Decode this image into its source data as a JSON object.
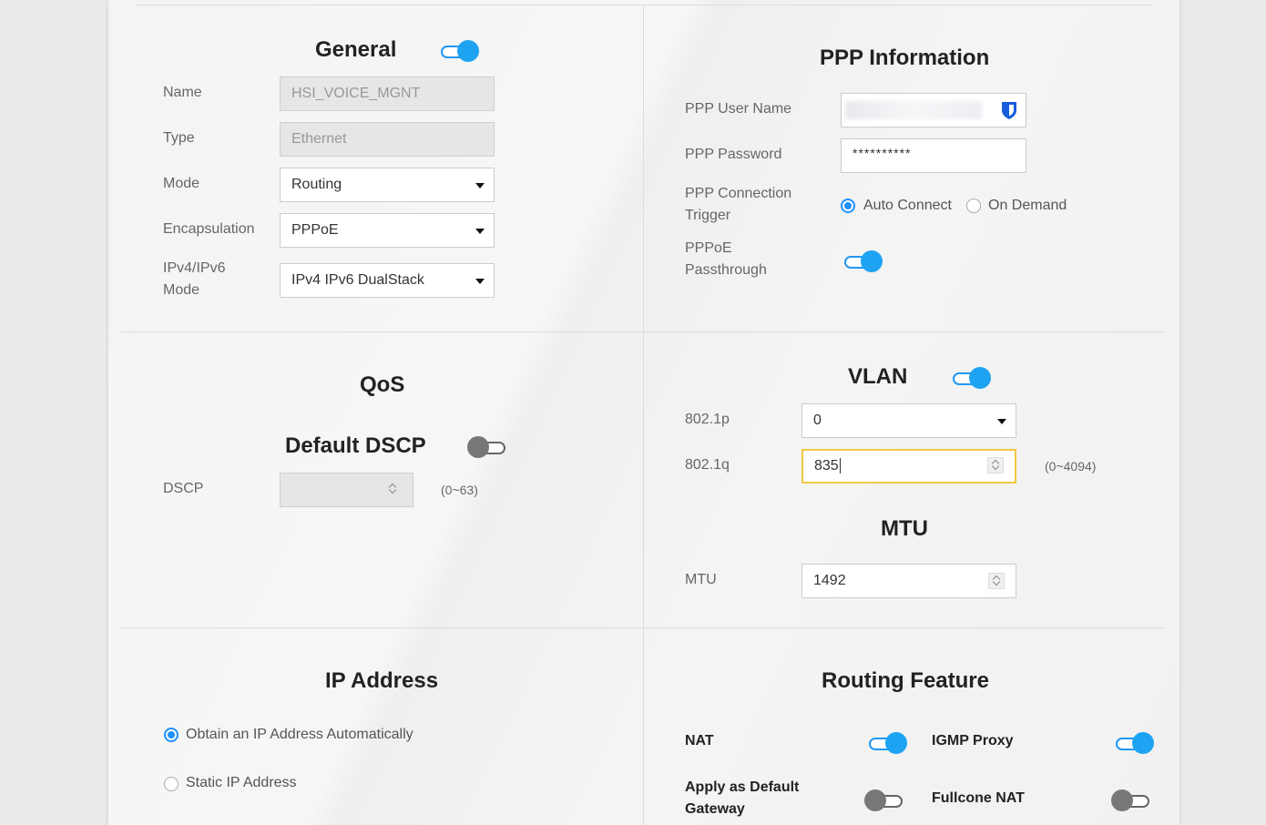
{
  "general": {
    "title": "General",
    "name_label": "Name",
    "name_value": "HSI_VOICE_MGNT",
    "type_label": "Type",
    "type_value": "Ethernet",
    "mode_label": "Mode",
    "mode_value": "Routing",
    "encap_label": "Encapsulation",
    "encap_value": "PPPoE",
    "ipmode_label_1": "IPv4/IPv6",
    "ipmode_label_2": "Mode",
    "ipmode_value": "IPv4 IPv6 DualStack",
    "enabled": true
  },
  "ppp": {
    "title": "PPP Information",
    "user_label": "PPP User Name",
    "user_value": "",
    "password_label": "PPP Password",
    "password_value": "**********",
    "trigger_label_1": "PPP Connection",
    "trigger_label_2": "Trigger",
    "auto_connect": "Auto Connect",
    "on_demand": "On Demand",
    "passthrough_label_1": "PPPoE",
    "passthrough_label_2": "Passthrough",
    "passthrough_enabled": true
  },
  "qos": {
    "title": "QoS",
    "dscp_title": "Default DSCP",
    "dscp_enabled": false,
    "dscp_label": "DSCP",
    "dscp_value": "",
    "dscp_range": "(0~63)"
  },
  "vlan": {
    "title": "VLAN",
    "enabled": true,
    "p_label": "802.1p",
    "p_value": "0",
    "q_label": "802.1q",
    "q_value": "835",
    "q_range": "(0~4094)"
  },
  "mtu": {
    "title": "MTU",
    "label": "MTU",
    "value": "1492"
  },
  "ip": {
    "title": "IP Address",
    "auto": "Obtain an IP Address Automatically",
    "static": "Static IP Address"
  },
  "routing": {
    "title": "Routing Feature",
    "nat": "NAT",
    "nat_enabled": true,
    "igmp": "IGMP Proxy",
    "igmp_enabled": true,
    "gateway_1": "Apply as Default",
    "gateway_2": "Gateway",
    "gateway_enabled": false,
    "fullcone": "Fullcone NAT",
    "fullcone_enabled": false
  },
  "colors": {
    "accent": "#1ea3f3",
    "focus": "#f2c744"
  }
}
